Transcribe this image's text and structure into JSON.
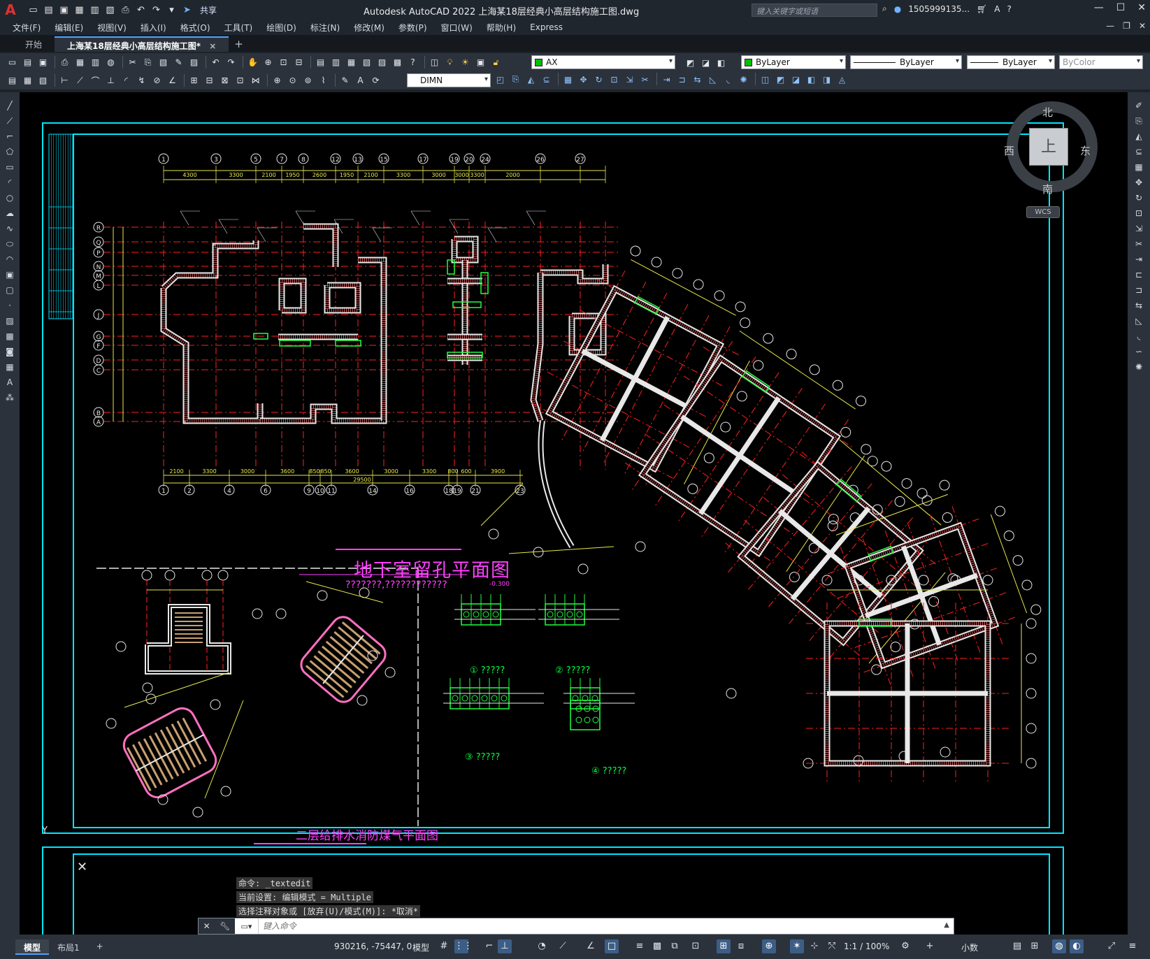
{
  "app": {
    "logo": "A",
    "share_label": "共享",
    "title": "Autodesk AutoCAD 2022    上海某18层经典小高层结构施工图.dwg",
    "search_placeholder": "键入关键字或短语",
    "user": "1505999135...",
    "help": "?"
  },
  "menu": [
    "文件(F)",
    "编辑(E)",
    "视图(V)",
    "插入(I)",
    "格式(O)",
    "工具(T)",
    "绘图(D)",
    "标注(N)",
    "修改(M)",
    "参数(P)",
    "窗口(W)",
    "帮助(H)",
    "Express"
  ],
  "tabs": {
    "start": "开始",
    "active": "上海某18层经典小高层结构施工图*",
    "close": "×",
    "new": "+"
  },
  "toolbar": {
    "layer_name": "AX",
    "layer_color": "#00c000",
    "color_value": "ByLayer",
    "linetype_value": "ByLayer",
    "lineweight_value": "ByLayer",
    "plotstyle_value": "ByColor",
    "dimstyle_value": "DIMN"
  },
  "viewcube": {
    "north": "北",
    "south": "南",
    "east": "东",
    "west": "西",
    "top": "上",
    "wcs": "WCS"
  },
  "drawing": {
    "plan_title": "地下室留孔平面图",
    "plan_subtitle": "???????,????????????",
    "plan_level": "-0.300",
    "gas_title": "二层给排水消防煤气平面图",
    "details": [
      "① ?????",
      "② ?????",
      "③ ?????",
      "④ ?????"
    ],
    "axis_top": [
      "1",
      "3",
      "5",
      "7",
      "8",
      "12",
      "13",
      "15",
      "17",
      "19",
      "20",
      "24",
      "26",
      "27"
    ],
    "axis_bottom": [
      "1",
      "2",
      "4",
      "6",
      "9",
      "10",
      "11",
      "14",
      "16",
      "18",
      "19",
      "21",
      "23"
    ],
    "axis_left": [
      "R",
      "Q",
      "P",
      "N",
      "M",
      "L",
      "J",
      "G",
      "F",
      "D",
      "C",
      "B",
      "A"
    ],
    "dims_top": [
      "4300",
      "3300",
      "2100",
      "1950",
      "2600",
      "1950",
      "2100",
      "3300",
      "3000",
      "3000",
      "3300",
      "2000"
    ],
    "dims_bottom": [
      "2100",
      "3300",
      "3000",
      "3600",
      "850",
      "850",
      "3600",
      "3000",
      "3300",
      "800",
      "600",
      "3900"
    ],
    "dim_total": "29500",
    "ucs_y": "Y"
  },
  "command": {
    "history": [
      "命令: _textedit",
      "当前设置: 编辑模式 = Multiple",
      "选择注释对象或 [放弃(U)/模式(M)]: *取消*"
    ],
    "placeholder": "键入命令"
  },
  "status": {
    "tab_model": "模型",
    "tab_layout": "布局1",
    "tab_add": "+",
    "coords": "930216, -75447, 0",
    "space": "模型",
    "scale": "1:1 / 100%",
    "units": "小数"
  }
}
